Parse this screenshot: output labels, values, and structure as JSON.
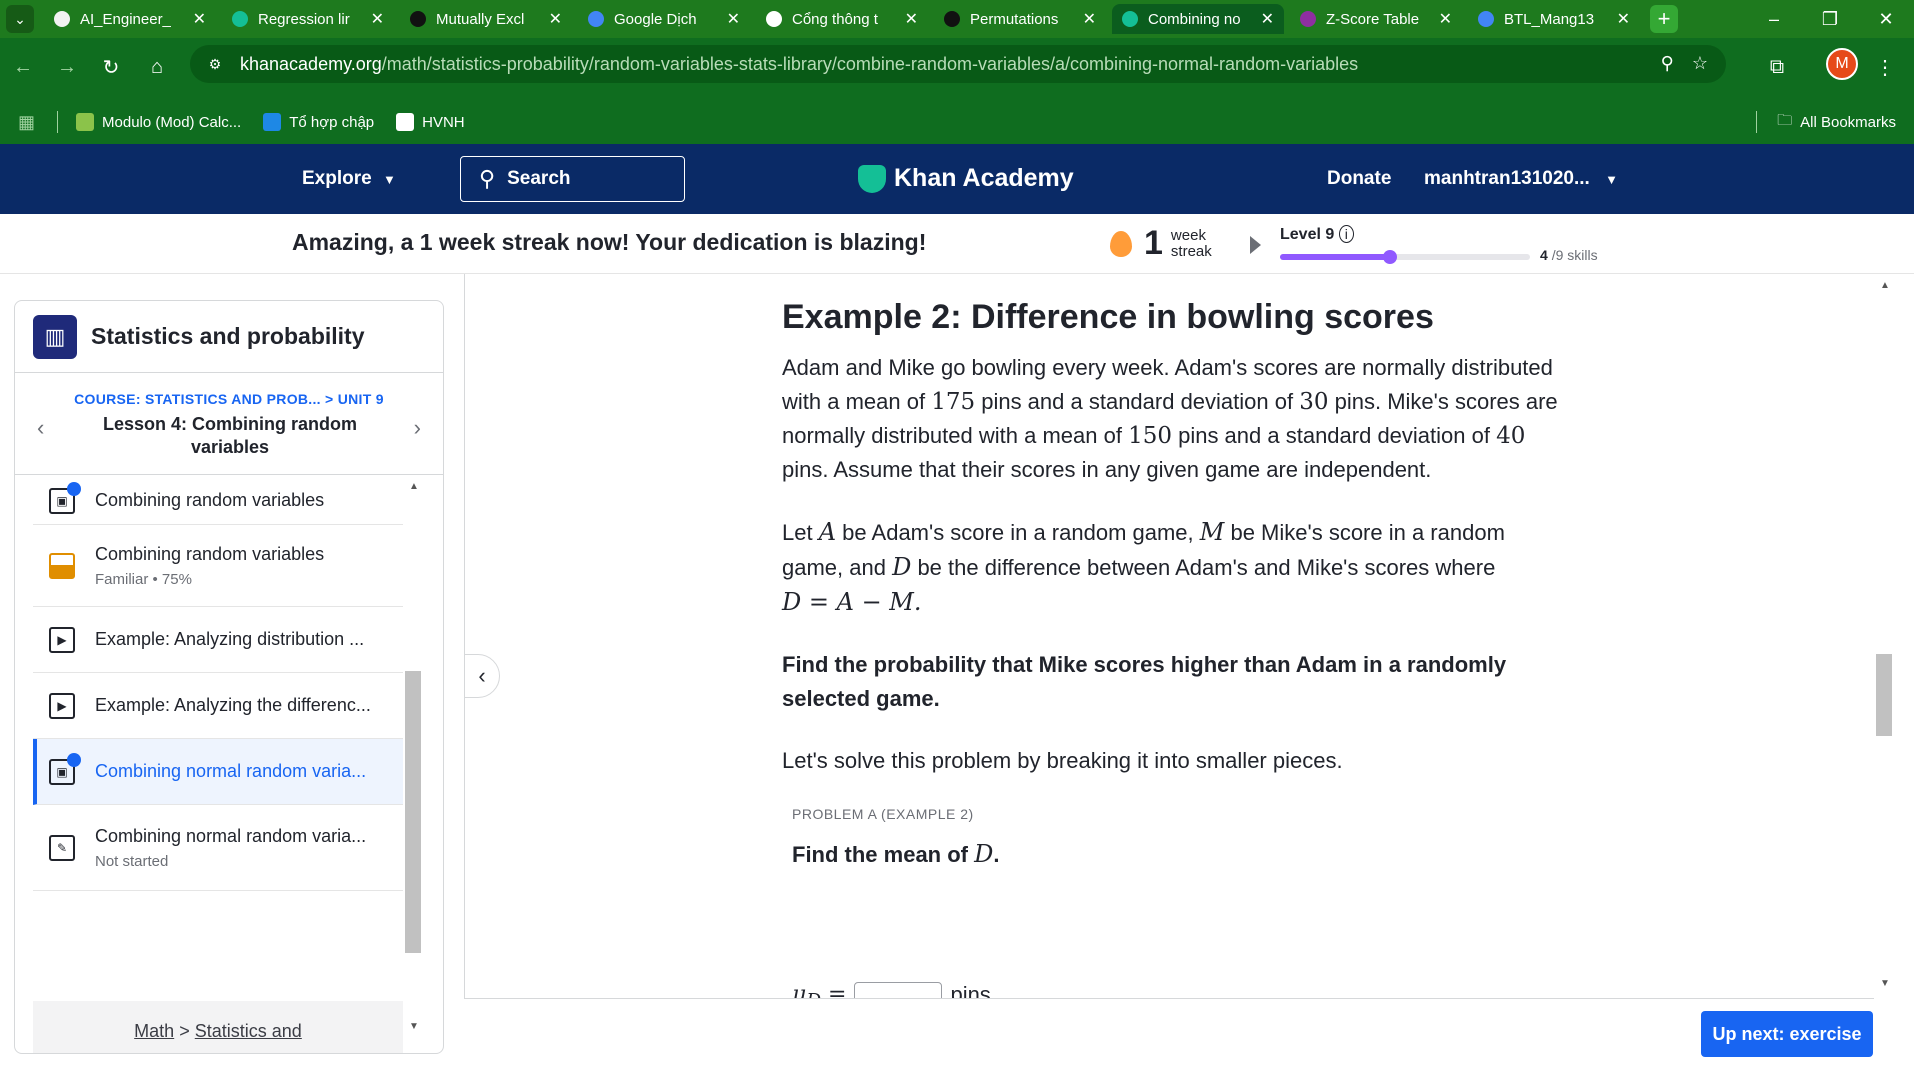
{
  "browser": {
    "tabs": [
      {
        "label": "AI_Engineer_",
        "color": "#f2f2f2",
        "active": false
      },
      {
        "label": "Regression lir",
        "color": "#14bf96",
        "active": false
      },
      {
        "label": "Mutually Excl",
        "color": "#111111",
        "active": false
      },
      {
        "label": "Google Dịch",
        "color": "#4285f4",
        "active": false
      },
      {
        "label": "Cổng thông t",
        "color": "#ffffff",
        "active": false
      },
      {
        "label": "Permutations",
        "color": "#111111",
        "active": false
      },
      {
        "label": "Combining no",
        "color": "#14bf96",
        "active": true
      },
      {
        "label": "Z-Score Table",
        "color": "#8e2fa0",
        "active": false
      },
      {
        "label": "BTL_Mang13",
        "color": "#4285f4",
        "active": false
      }
    ],
    "url_host": "khanacademy.org",
    "url_path": "/math/statistics-probability/random-variables-stats-library/combine-random-variables/a/combining-normal-random-variables",
    "profile_initial": "M",
    "bookmarks": [
      {
        "label": "Modulo (Mod) Calc...",
        "color": "#8bc34a"
      },
      {
        "label": "Tổ hợp chập",
        "color": "#1e88e5"
      },
      {
        "label": "HVNH",
        "color": "#ffffff"
      }
    ],
    "all_bookmarks": "All Bookmarks"
  },
  "ka_header": {
    "explore": "Explore",
    "search": "Search",
    "logo": "Khan Academy",
    "donate": "Donate",
    "user": "manhtran131020..."
  },
  "streak": {
    "message": "Amazing, a 1 week streak now! Your dedication is blazing!",
    "count": "1",
    "unit_line1": "week",
    "unit_line2": "streak",
    "level": "Level 9",
    "skills_done": "4",
    "skills_total": "/9 skills",
    "level_progress": 0.44
  },
  "sidebar": {
    "title": "Statistics and probability",
    "crumb": "COURSE: STATISTICS AND PROB...  > UNIT 9",
    "lesson": "Lesson 4: Combining random variables",
    "items": [
      {
        "label": "Combining random variables",
        "sub": "",
        "kind": "article-done"
      },
      {
        "label": "Combining random variables",
        "sub": "Familiar • 75%",
        "kind": "skill"
      },
      {
        "label": "Example: Analyzing distribution ...",
        "sub": "",
        "kind": "video"
      },
      {
        "label": "Example: Analyzing the differenc...",
        "sub": "",
        "kind": "video"
      },
      {
        "label": "Combining normal random varia...",
        "sub": "",
        "kind": "article-active"
      },
      {
        "label": "Combining normal random varia...",
        "sub": "Not started",
        "kind": "exercise"
      }
    ],
    "footer_math": "Math",
    "footer_sep": ">",
    "footer_stats": "Statistics and"
  },
  "article": {
    "heading": "Example 2: Difference in bowling scores",
    "p1_a": "Adam and Mike go bowling every week. Adam's scores are normally distributed with a mean of ",
    "p1_n1": "175",
    "p1_b": " pins and a standard deviation of ",
    "p1_n2": "30",
    "p1_c": " pins. Mike's scores are normally distributed with a mean of ",
    "p1_n3": "150",
    "p1_d": " pins and a standard deviation of ",
    "p1_n4": "40",
    "p1_e": " pins. Assume that their scores in any given game are independent.",
    "p2_a": "Let ",
    "p2_A": "A",
    "p2_b": " be Adam's score in a random game, ",
    "p2_M": "M",
    "p2_c": " be Mike's score in a random game, and ",
    "p2_D": "D",
    "p2_d": " be the difference between Adam's and Mike's scores where",
    "p2_eq": "D = A − M.",
    "p3": "Find the probability that Mike scores higher than Adam in a randomly selected game.",
    "p4": "Let's solve this problem by breaking it into smaller pieces.",
    "problem_label": "PROBLEM A (EXAMPLE 2)",
    "problem_q_a": "Find the mean of ",
    "problem_q_D": "D",
    "problem_q_b": ".",
    "answer_prefix": "μ",
    "answer_sub": "D",
    "answer_eq": " =",
    "answer_unit": "pins"
  },
  "up_next": "Up next: exercise"
}
